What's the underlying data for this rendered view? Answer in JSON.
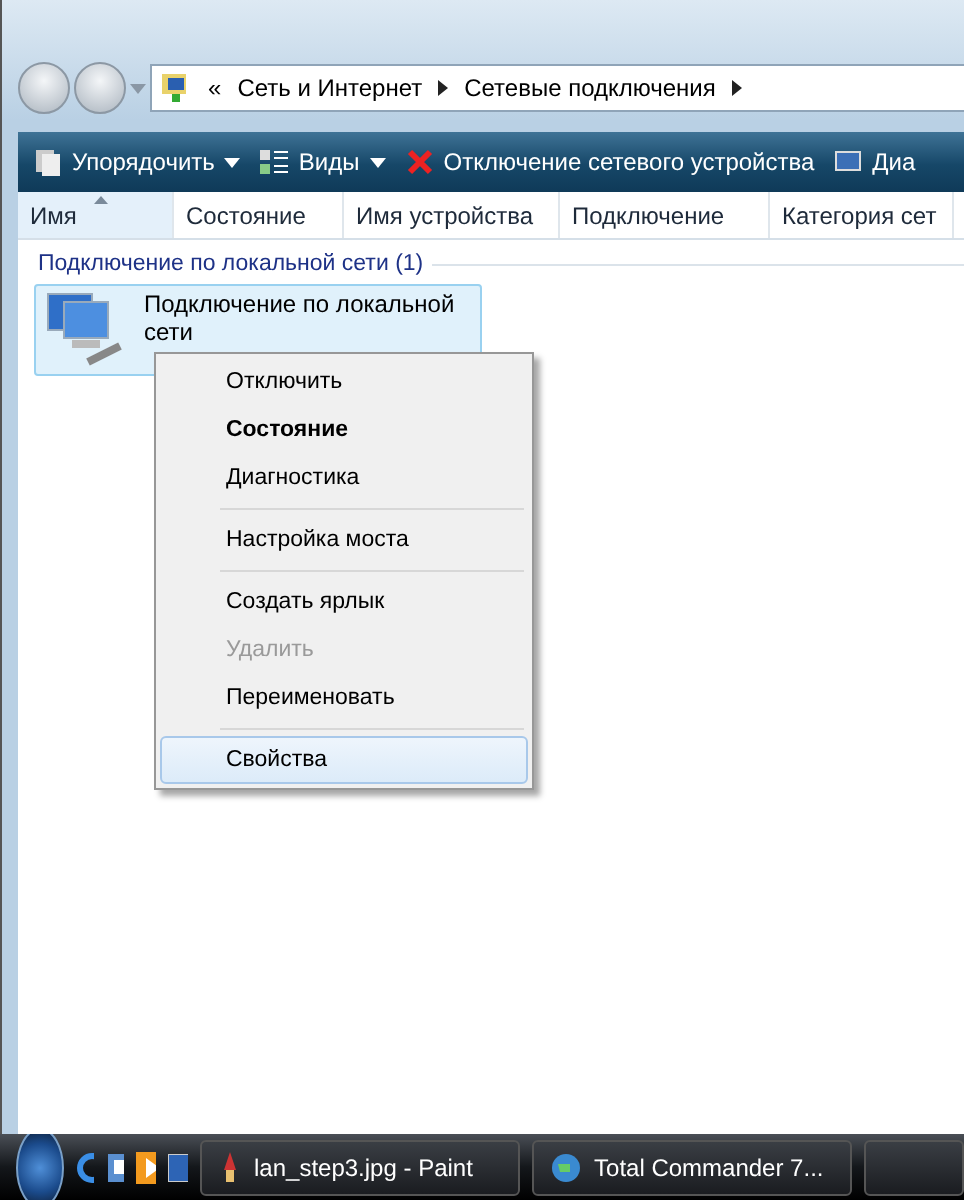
{
  "address_bar": {
    "overflow": "«",
    "crumbs": [
      "Сеть и Интернет",
      "Сетевые подключения"
    ]
  },
  "toolbar": [
    {
      "label": "Упорядочить",
      "kind": "menu"
    },
    {
      "label": "Виды",
      "kind": "menu"
    },
    {
      "label": "Отключение сетевого устройства",
      "kind": "action"
    },
    {
      "label": "Диа",
      "kind": "cut"
    }
  ],
  "columns": [
    {
      "label": "Имя",
      "sorted": true
    },
    {
      "label": "Состояние",
      "sorted": false
    },
    {
      "label": "Имя устройства",
      "sorted": false
    },
    {
      "label": "Подключение",
      "sorted": false
    },
    {
      "label": "Категория сет",
      "sorted": false
    }
  ],
  "group": {
    "title": "Подключение по локальной сети (1)"
  },
  "item": {
    "title": "Подключение по локальной сети",
    "selected": true
  },
  "context_menu": [
    {
      "kind": "item",
      "label": "Отключить",
      "default": false,
      "disabled": false,
      "selected": false
    },
    {
      "kind": "item",
      "label": "Состояние",
      "default": true,
      "disabled": false,
      "selected": false
    },
    {
      "kind": "item",
      "label": "Диагностика",
      "default": false,
      "disabled": false,
      "selected": false
    },
    {
      "kind": "separator"
    },
    {
      "kind": "item",
      "label": "Настройка моста",
      "default": false,
      "disabled": false,
      "selected": false
    },
    {
      "kind": "separator"
    },
    {
      "kind": "item",
      "label": "Создать ярлык",
      "default": false,
      "disabled": false,
      "selected": false
    },
    {
      "kind": "item",
      "label": "Удалить",
      "default": false,
      "disabled": true,
      "selected": false
    },
    {
      "kind": "item",
      "label": "Переименовать",
      "default": false,
      "disabled": false,
      "selected": false
    },
    {
      "kind": "separator"
    },
    {
      "kind": "item",
      "label": "Свойства",
      "default": false,
      "disabled": false,
      "selected": true
    }
  ],
  "taskbar": {
    "tasks": [
      {
        "label": "lan_step3.jpg - Paint",
        "kind": "paint"
      },
      {
        "label": "Total Commander 7...",
        "kind": "globe"
      }
    ]
  }
}
